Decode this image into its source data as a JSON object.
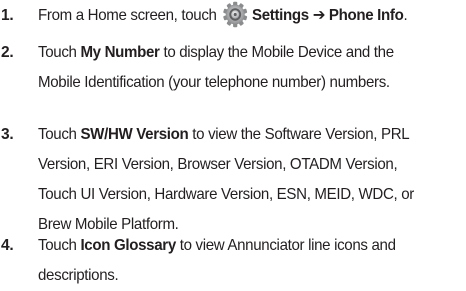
{
  "steps": [
    {
      "number": "1.",
      "lines": [
        {
          "parts": [
            {
              "t": "From a Home screen, touch ",
              "b": false
            },
            {
              "icon": "settings-gear-icon"
            },
            {
              "t": "Settings",
              "b": true
            },
            {
              "t": " ➔ ",
              "b": false
            },
            {
              "t": "Phone Info",
              "b": true
            },
            {
              "t": ".",
              "b": false
            }
          ]
        }
      ]
    },
    {
      "number": "2.",
      "lines": [
        {
          "parts": [
            {
              "t": "Touch ",
              "b": false
            },
            {
              "t": "My Number",
              "b": true
            },
            {
              "t": " to display the Mobile Device and the",
              "b": false
            }
          ]
        },
        {
          "parts": [
            {
              "t": "Mobile Identification (your telephone number) numbers.",
              "b": false
            }
          ]
        }
      ]
    },
    {
      "number": "3.",
      "lines": [
        {
          "parts": [
            {
              "t": "Touch ",
              "b": false
            },
            {
              "t": "SW/HW Version",
              "b": true
            },
            {
              "t": " to view the Software Version, PRL",
              "b": false
            }
          ]
        },
        {
          "parts": [
            {
              "t": "Version, ERI Version, Browser Version, OTADM Version,",
              "b": false
            }
          ]
        },
        {
          "parts": [
            {
              "t": "Touch UI Version, Hardware Version, ESN, MEID, WDC, or",
              "b": false
            }
          ]
        },
        {
          "parts": [
            {
              "t": "Brew Mobile Platform.",
              "b": false
            }
          ]
        }
      ]
    },
    {
      "number": "4.",
      "lines": [
        {
          "parts": [
            {
              "t": "Touch ",
              "b": false
            },
            {
              "t": "Icon Glossary",
              "b": true
            },
            {
              "t": " to view Annunciator line icons and",
              "b": false
            }
          ]
        },
        {
          "parts": [
            {
              "t": "descriptions.",
              "b": false
            }
          ]
        }
      ]
    }
  ],
  "colors": {
    "text": "#231f20",
    "gear_outer": "#8a8c8e",
    "gear_inner": "#5e6062"
  }
}
